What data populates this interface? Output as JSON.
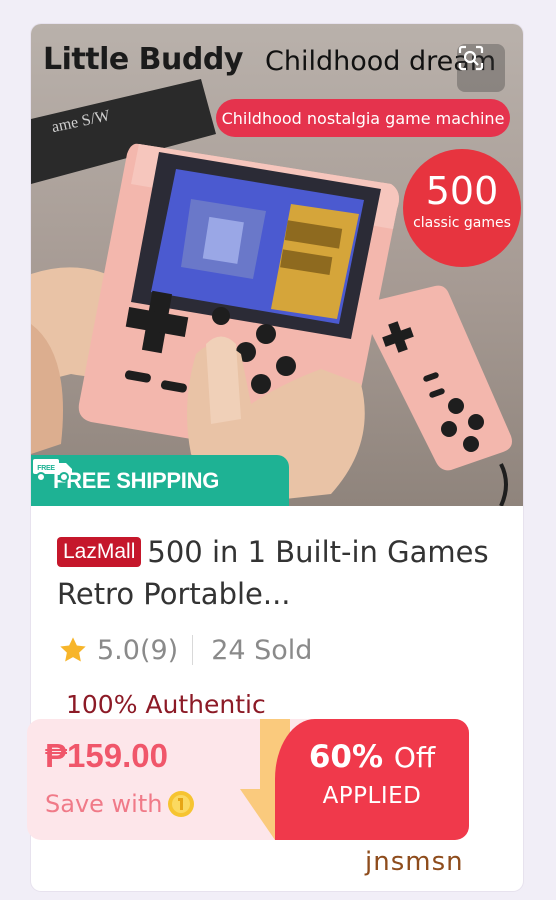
{
  "hero": {
    "brand": "Little Buddy",
    "brand_sub": "Childhood dream",
    "pill": "Childhood nostalgia game machine",
    "badge_number": "500",
    "badge_text": "classic games",
    "shipping_icon_text": "FREE",
    "shipping_label": "FREE SHIPPING"
  },
  "product": {
    "mall_badge": "LazMall",
    "title": "500 in 1 Built-in Games Retro Portable...",
    "rating": "5.0(9)",
    "sold": "24 Sold",
    "authentic": "100% Authentic"
  },
  "promo": {
    "price": "₱159.00",
    "save_with": "Save with",
    "discount": "60%",
    "off": "Off",
    "applied": "APPLIED"
  },
  "watermark": "jnsmsn",
  "colors": {
    "accent_red": "#e5334d",
    "lazmall_red": "#c5172b",
    "shipping_green": "#1eb294",
    "authentic_text": "#8c1a26",
    "promo_bg": "#fde6ea"
  },
  "icons": [
    "image-search-icon",
    "free-shipping-truck-icon",
    "star-icon",
    "coin-icon",
    "down-arrow-icon"
  ]
}
